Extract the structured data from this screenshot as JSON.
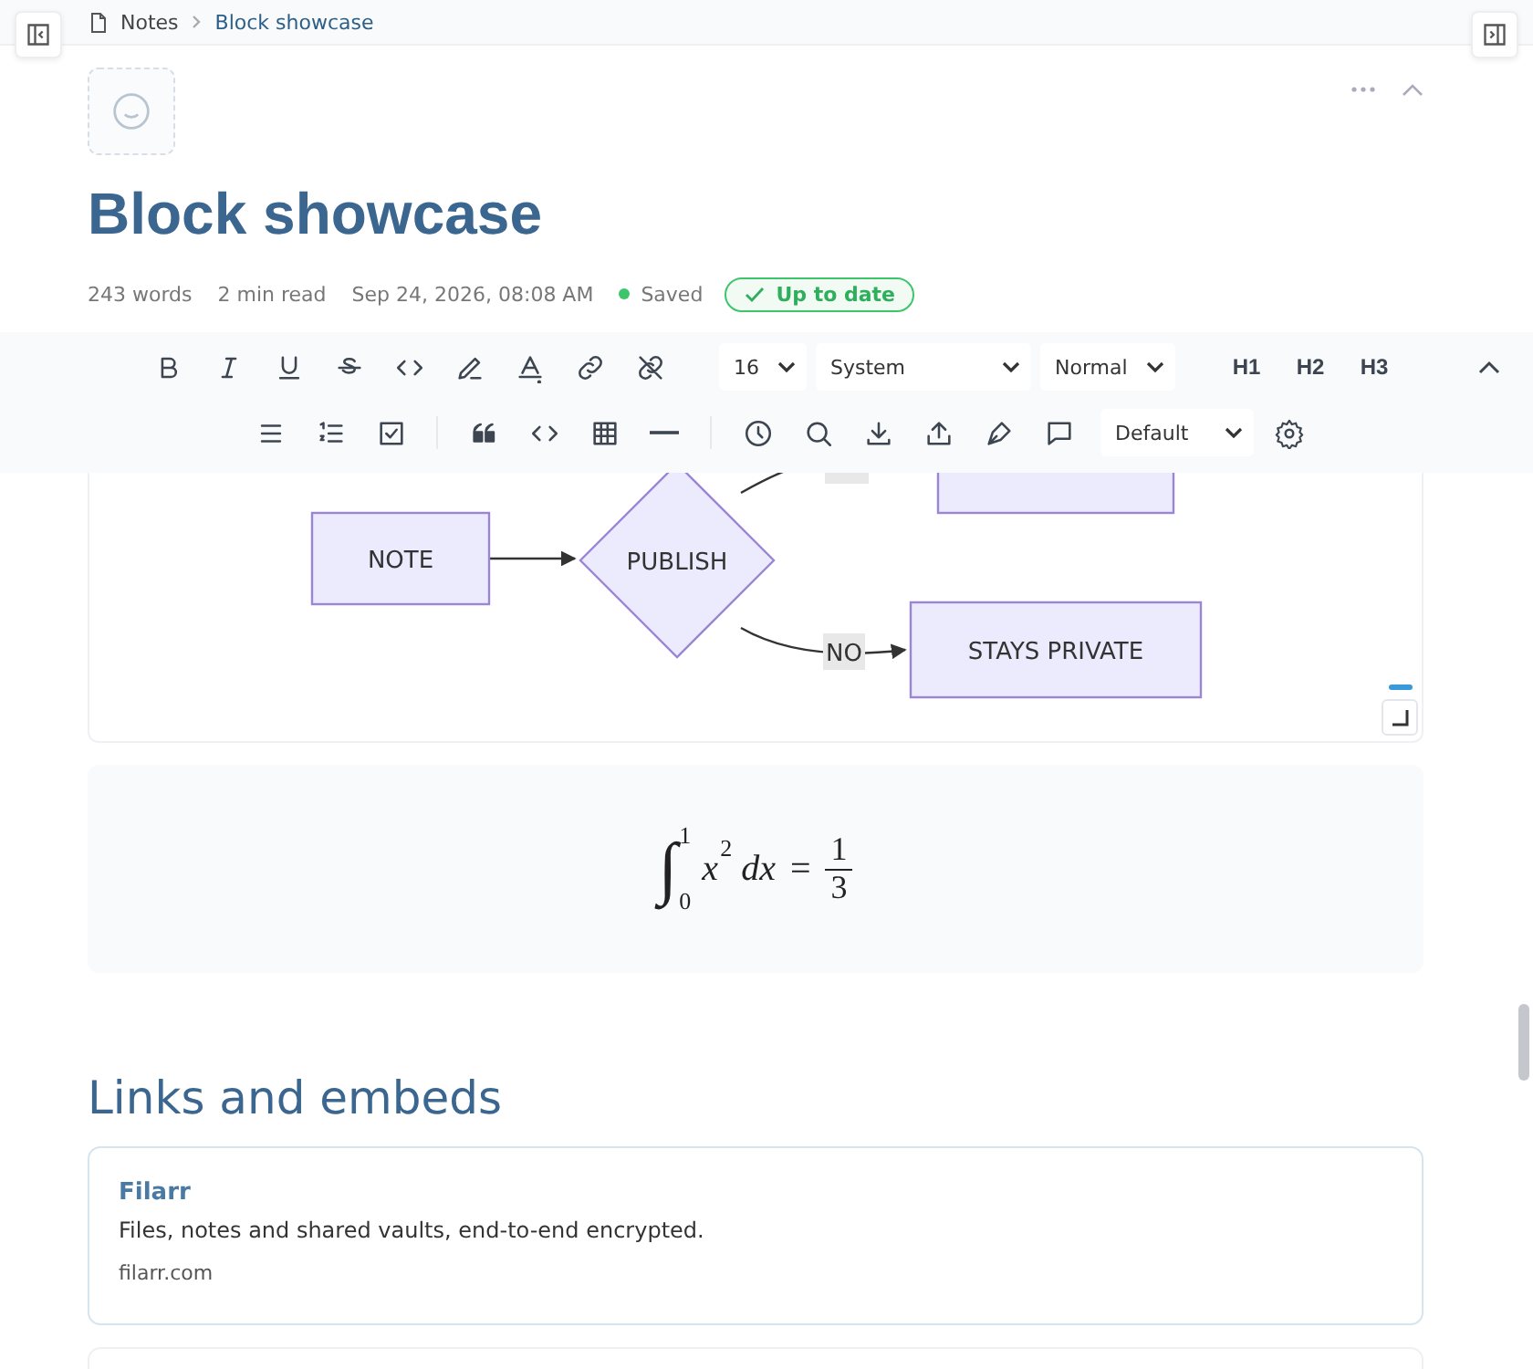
{
  "breadcrumb": [
    {
      "label": "Notes",
      "kind": "root"
    },
    {
      "label": "Block showcase",
      "kind": "current"
    }
  ],
  "title": "Block showcase",
  "meta": {
    "words": "243 words",
    "read_time": "2 min read",
    "date": "Sep 24, 2026, 08:08 AM",
    "save_status": "Saved",
    "sync_badge": "Up to date"
  },
  "toolbar": {
    "font_size": "16",
    "font_family": "System",
    "text_style": "Normal",
    "headings": [
      "H1",
      "H2",
      "H3"
    ],
    "theme": "Default"
  },
  "diagram": {
    "nodes": [
      {
        "kind": "rect",
        "label": "NOTE"
      },
      {
        "kind": "diamond",
        "label": "PUBLISH"
      },
      {
        "kind": "rect"
      },
      {
        "kind": "rect",
        "label": "STAYS PRIVATE"
      }
    ],
    "edges": [
      {
        "kind": "arrow"
      },
      {
        "kind": "line"
      },
      {
        "kind": "arrow",
        "label": "NO"
      }
    ]
  },
  "math": {
    "integral_sign": "∫",
    "lower": "0",
    "upper": "1",
    "base": "x",
    "exponent": "2",
    "differential": "dx",
    "equals": "=",
    "numerator": "1",
    "denominator": "3"
  },
  "section_heading": "Links and embeds",
  "link_cards": [
    {
      "title": "Filarr",
      "description": "Files, notes and shared vaults, end-to-end encrypted.",
      "domain": "filarr.com"
    }
  ]
}
